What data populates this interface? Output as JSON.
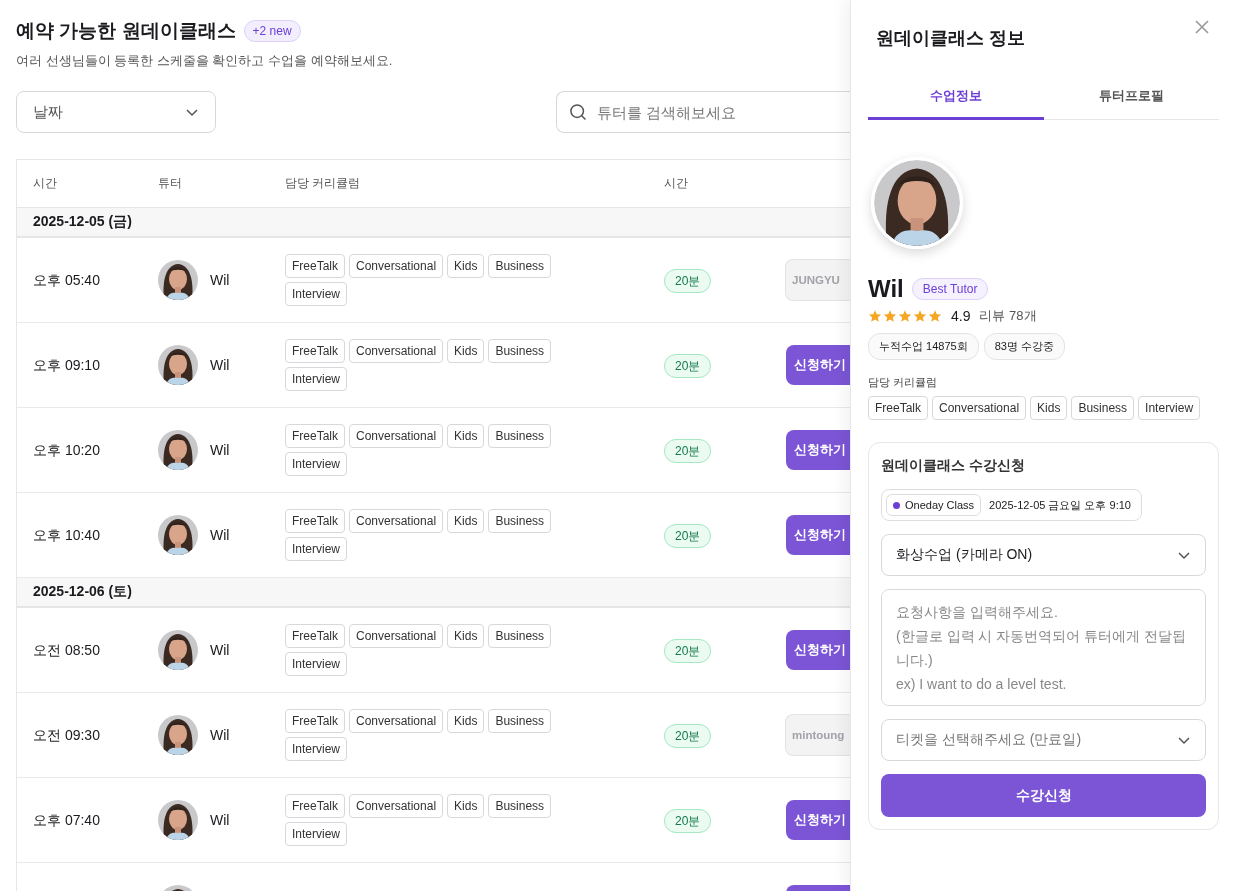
{
  "header": {
    "title": "예약 가능한 원데이클래스",
    "badge": "+2 new",
    "subtitle": "여러 선생님들이 등록한 스케줄을 확인하고 수업을 예약해보세요."
  },
  "filters": {
    "date_select": "날짜",
    "search": {
      "placeholder": "튜터를 검색해보세요"
    }
  },
  "table": {
    "columns": [
      "시간",
      "튜터",
      "담당 커리큘럼",
      "시간"
    ],
    "groups": [
      {
        "date": "2025-12-05 (금)",
        "rows": [
          {
            "time": "오후 05:40",
            "tutor": "Wil",
            "tags": [
              "FreeTalk",
              "Conversational",
              "Kids",
              "Business",
              "Interview"
            ],
            "duration": "20분",
            "action": {
              "kind": "booked",
              "label": "JUNGYU"
            }
          },
          {
            "time": "오후 09:10",
            "tutor": "Wil",
            "tags": [
              "FreeTalk",
              "Conversational",
              "Kids",
              "Business",
              "Interview"
            ],
            "duration": "20분",
            "action": {
              "kind": "apply",
              "label": "신청하기"
            }
          },
          {
            "time": "오후 10:20",
            "tutor": "Wil",
            "tags": [
              "FreeTalk",
              "Conversational",
              "Kids",
              "Business",
              "Interview"
            ],
            "duration": "20분",
            "action": {
              "kind": "apply",
              "label": "신청하기"
            }
          },
          {
            "time": "오후 10:40",
            "tutor": "Wil",
            "tags": [
              "FreeTalk",
              "Conversational",
              "Kids",
              "Business",
              "Interview"
            ],
            "duration": "20분",
            "action": {
              "kind": "apply",
              "label": "신청하기"
            }
          }
        ]
      },
      {
        "date": "2025-12-06 (토)",
        "rows": [
          {
            "time": "오전 08:50",
            "tutor": "Wil",
            "tags": [
              "FreeTalk",
              "Conversational",
              "Kids",
              "Business",
              "Interview"
            ],
            "duration": "20분",
            "action": {
              "kind": "apply",
              "label": "신청하기"
            }
          },
          {
            "time": "오전 09:30",
            "tutor": "Wil",
            "tags": [
              "FreeTalk",
              "Conversational",
              "Kids",
              "Business",
              "Interview"
            ],
            "duration": "20분",
            "action": {
              "kind": "booked",
              "label": "mintoung"
            }
          },
          {
            "time": "오후 07:40",
            "tutor": "Wil",
            "tags": [
              "FreeTalk",
              "Conversational",
              "Kids",
              "Business",
              "Interview"
            ],
            "duration": "20분",
            "action": {
              "kind": "apply",
              "label": "신청하기"
            }
          },
          {
            "action": {
              "kind": "apply"
            }
          }
        ]
      }
    ]
  },
  "panel": {
    "title": "원데이클래스 정보",
    "tabs": [
      {
        "label": "수업정보",
        "selected": true
      },
      {
        "label": "튜터프로필",
        "selected": false
      }
    ],
    "tutor": {
      "name": "Wil",
      "badge": "Best Tutor",
      "stars": 5,
      "rating": "4.9",
      "reviews": "리뷰 78개",
      "stats": [
        "누적수업 14875회",
        "83명 수강중"
      ],
      "curriculum_label": "담당 커리큘럼",
      "tags": [
        "FreeTalk",
        "Conversational",
        "Kids",
        "Business",
        "Interview"
      ]
    },
    "booking": {
      "title": "원데이클래스 수강신청",
      "class_chip": {
        "label": "Oneday Class",
        "color": "#6b3fd4"
      },
      "datetime": "2025-12-05 금요일 오후 9:10",
      "lesson_select": "화상수업 (카메라 ON)",
      "request": {
        "placeholder": "요청사항을 입력해주세요.\n(한글로 입력 시 자동번역되어 튜터에게 전달됩니다.)\nex) I want to do a level test."
      },
      "ticket_select": {
        "placeholder": "티켓을 선택해주세요 (만료일)"
      },
      "submit": "수강신청"
    }
  }
}
